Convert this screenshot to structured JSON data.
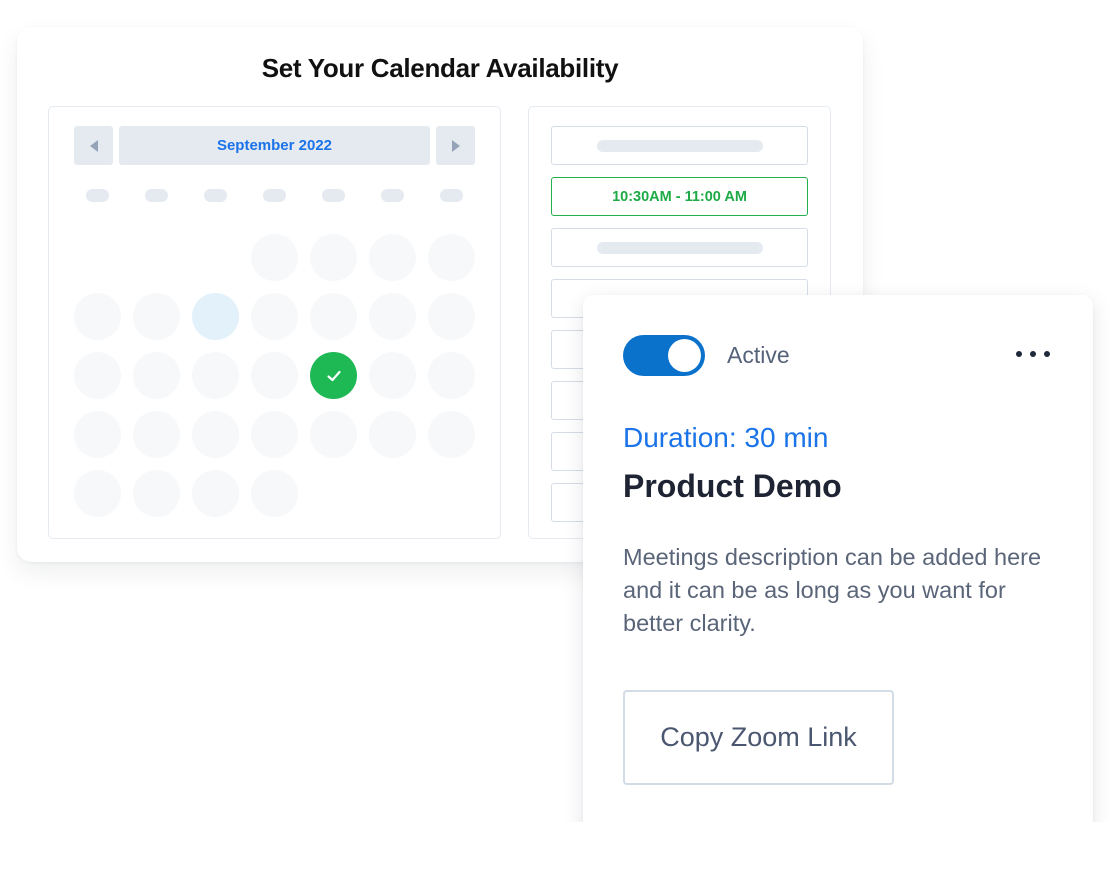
{
  "availability": {
    "title": "Set Your Calendar Availability",
    "calendar": {
      "month_label": "September 2022",
      "prev_icon": "triangle-left-icon",
      "next_icon": "triangle-right-icon",
      "weekday_count": 7,
      "weeks": [
        [
          null,
          null,
          null,
          "day",
          "day",
          "day",
          "day"
        ],
        [
          "day",
          "day",
          "highlight",
          "day",
          "day",
          "day",
          "day"
        ],
        [
          "day",
          "day",
          "day",
          "day",
          "selected",
          "day",
          "day"
        ],
        [
          "day",
          "day",
          "day",
          "day",
          "day",
          "day",
          "day"
        ],
        [
          "day",
          "day",
          "day",
          "day",
          null,
          null,
          null
        ]
      ],
      "selected_icon": "checkmark-icon"
    },
    "time_slots": [
      {
        "label": "",
        "state": "placeholder"
      },
      {
        "label": "10:30AM - 11:00 AM",
        "state": "selected"
      },
      {
        "label": "",
        "state": "placeholder"
      },
      {
        "label": "",
        "state": "empty"
      },
      {
        "label": "",
        "state": "empty"
      },
      {
        "label": "",
        "state": "empty"
      },
      {
        "label": "",
        "state": "empty"
      },
      {
        "label": "",
        "state": "empty"
      }
    ]
  },
  "event": {
    "toggle_on": true,
    "status_label": "Active",
    "more_icon": "more-horizontal-icon",
    "duration": "Duration: 30 min",
    "title": "Product Demo",
    "description": "Meetings description can be added here and it can be as long as you want for better clarity.",
    "copy_button_label": "Copy Zoom Link"
  },
  "colors": {
    "accent_blue": "#1a73e8",
    "toggle_blue": "#0b72cc",
    "success_green": "#1eb854",
    "highlight_blue": "#e3f1fb"
  }
}
